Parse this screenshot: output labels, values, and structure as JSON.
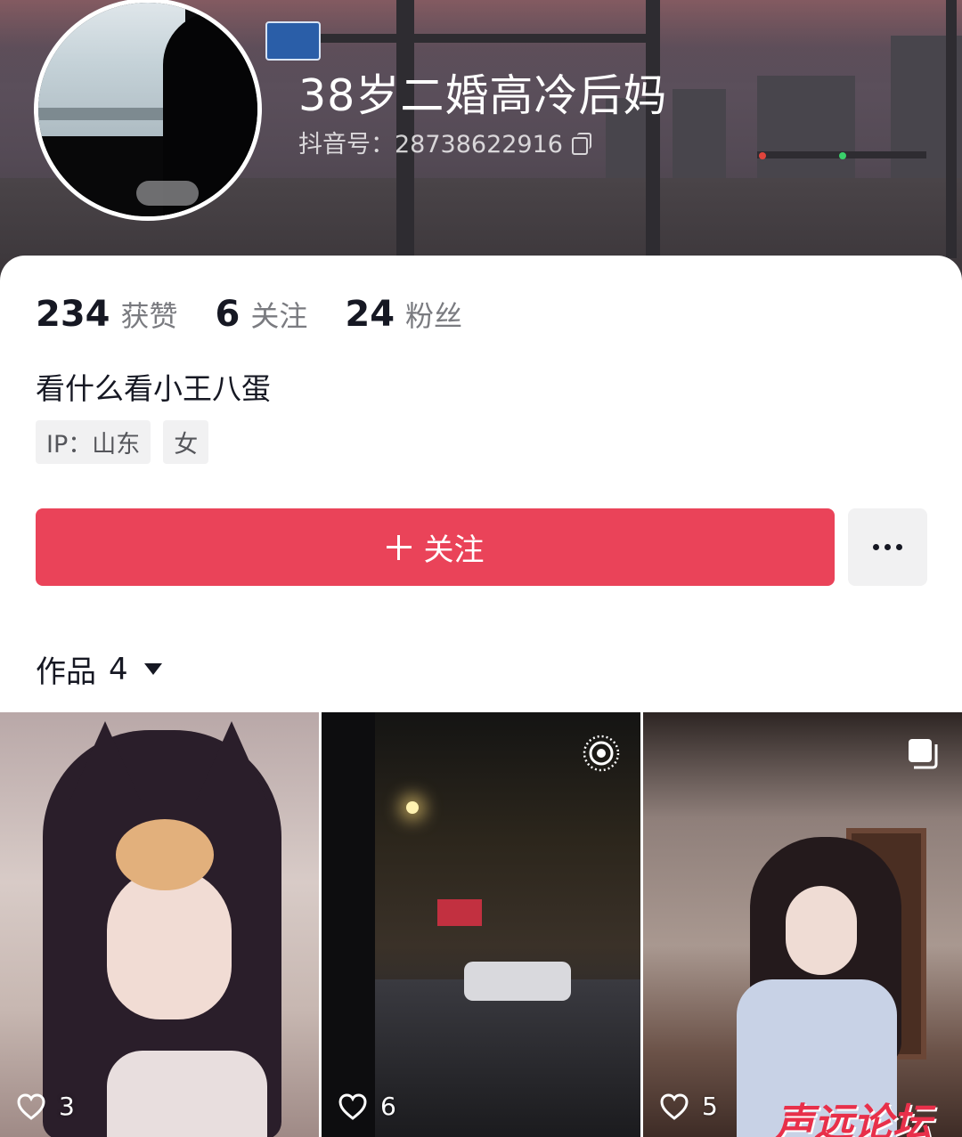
{
  "profile": {
    "username": "38岁二婚高冷后妈",
    "douyin_id": "抖音号：28738622916"
  },
  "stats": [
    {
      "value": "234",
      "label": "获赞"
    },
    {
      "value": "6",
      "label": "关注"
    },
    {
      "value": "24",
      "label": "粉丝"
    }
  ],
  "bio": "看什么看小王八蛋",
  "tags": [
    "IP：山东",
    "女"
  ],
  "actions": {
    "follow_label": "关注",
    "more_icon": "more-dots-icon"
  },
  "works": {
    "label": "作品",
    "count": "4"
  },
  "videos": [
    {
      "likes": "3",
      "badge": ""
    },
    {
      "likes": "6",
      "badge": "live-photo-icon"
    },
    {
      "likes": "5",
      "badge": "multi-image-icon"
    }
  ],
  "watermark": "声远论坛",
  "colors": {
    "accent": "#ea4359",
    "text_primary": "#161823",
    "text_secondary": "#7a7b80",
    "tag_bg": "#f1f1f2"
  }
}
